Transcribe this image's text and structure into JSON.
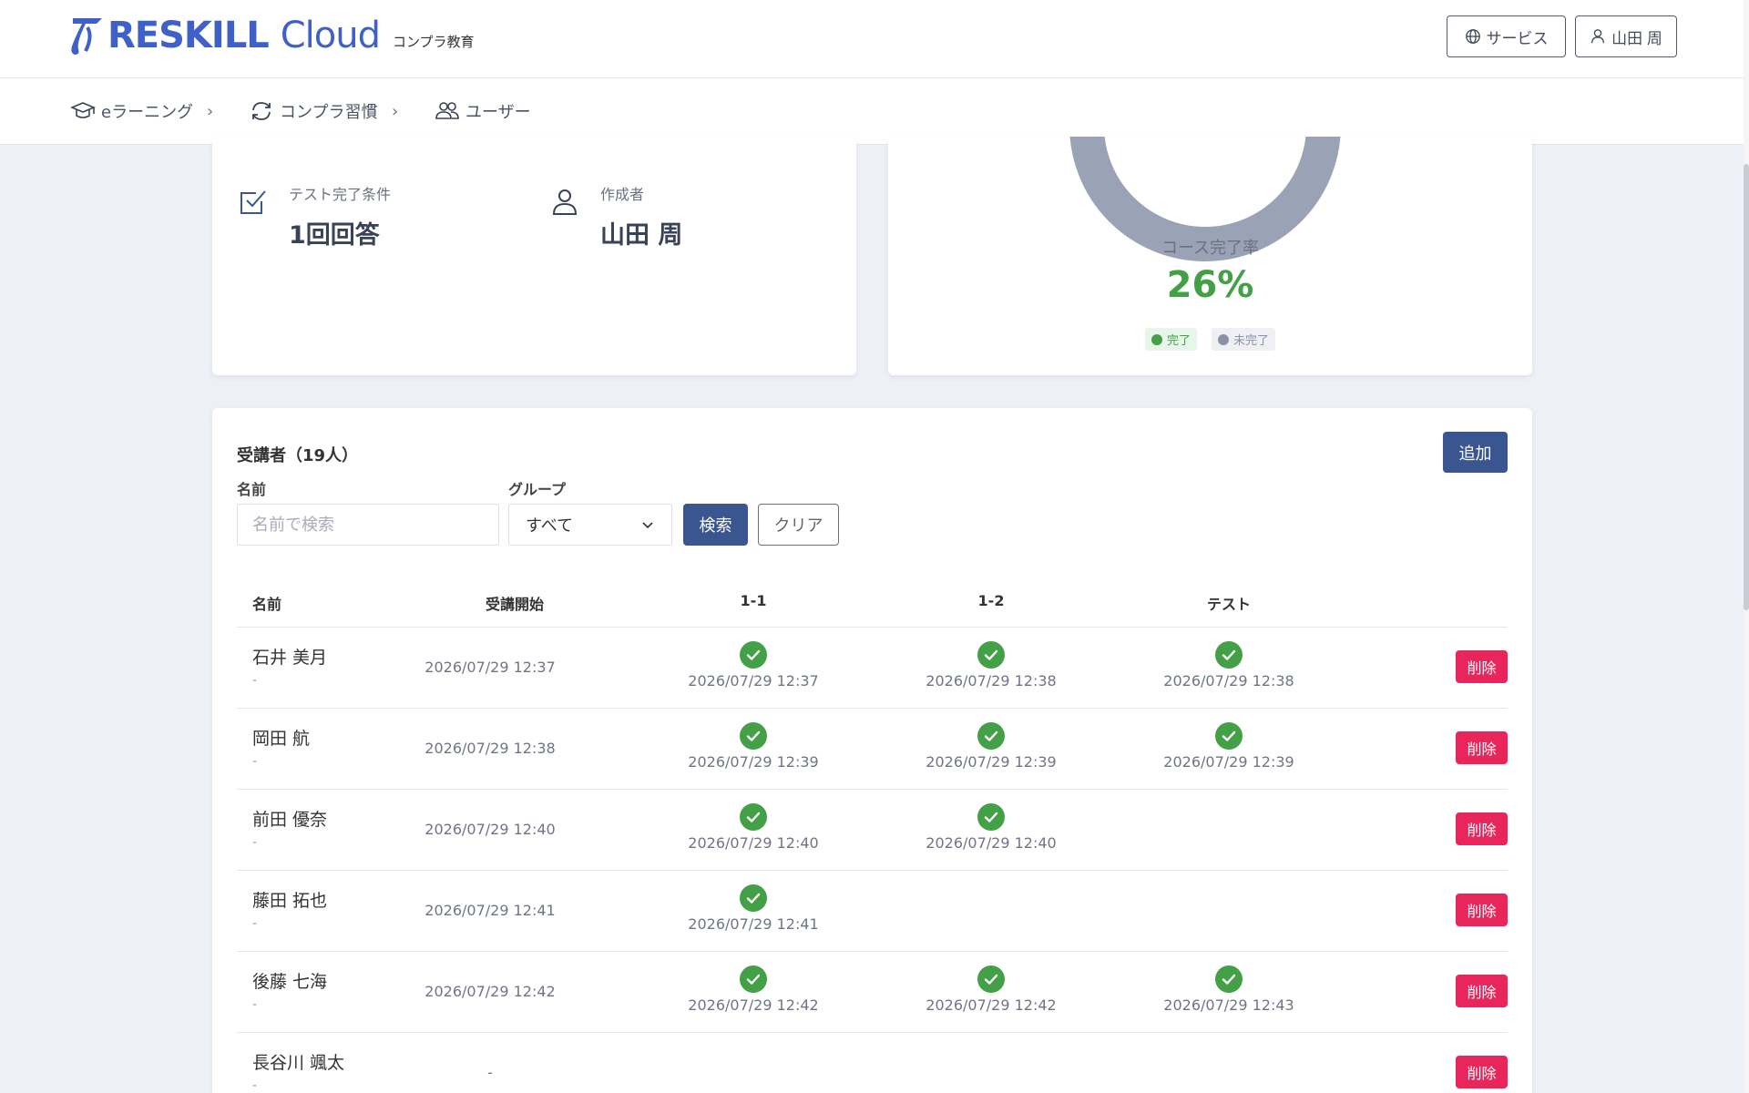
{
  "header": {
    "logo_main": "RESKILL",
    "logo_cloud": "Cloud",
    "subtitle": "コンプラ教育",
    "service_label": "サービス",
    "user_label": "山田 周"
  },
  "breadcrumb": {
    "items": [
      {
        "label": "eラーニング",
        "icon": "graduation-cap-icon"
      },
      {
        "label": "コンプラ習慣",
        "icon": "refresh-icon"
      },
      {
        "label": "ユーザー",
        "icon": "users-icon"
      }
    ]
  },
  "info": {
    "completion_condition_label": "テスト完了条件",
    "completion_condition_value": "1回回答",
    "author_label": "作成者",
    "author_value": "山田 周"
  },
  "chart": {
    "rate_label": "コース完了率",
    "rate_value": "26%",
    "legend_done": "完了",
    "legend_undone": "未完了",
    "colors": {
      "done": "#43a047",
      "undone": "#9aa3b5"
    }
  },
  "participants": {
    "title": "受講者（19人）",
    "add_label": "追加",
    "name_filter_label": "名前",
    "name_placeholder": "名前で検索",
    "group_filter_label": "グループ",
    "group_value": "すべて",
    "search_label": "検索",
    "clear_label": "クリア",
    "columns": {
      "name": "名前",
      "start": "受講開始",
      "c1": "1-1",
      "c2": "1-2",
      "test": "テスト"
    },
    "delete_label": "削除",
    "rows": [
      {
        "name": "石井 美月",
        "sub": "-",
        "start": "2026/07/29 12:37",
        "c1": "2026/07/29 12:37",
        "c2": "2026/07/29 12:38",
        "test": "2026/07/29 12:38"
      },
      {
        "name": "岡田 航",
        "sub": "-",
        "start": "2026/07/29 12:38",
        "c1": "2026/07/29 12:39",
        "c2": "2026/07/29 12:39",
        "test": "2026/07/29 12:39"
      },
      {
        "name": "前田 優奈",
        "sub": "-",
        "start": "2026/07/29 12:40",
        "c1": "2026/07/29 12:40",
        "c2": "2026/07/29 12:40",
        "test": ""
      },
      {
        "name": "藤田 拓也",
        "sub": "-",
        "start": "2026/07/29 12:41",
        "c1": "2026/07/29 12:41",
        "c2": "",
        "test": ""
      },
      {
        "name": "後藤 七海",
        "sub": "-",
        "start": "2026/07/29 12:42",
        "c1": "2026/07/29 12:42",
        "c2": "2026/07/29 12:42",
        "test": "2026/07/29 12:43"
      },
      {
        "name": "長谷川 颯太",
        "sub": "-",
        "start": "-",
        "c1": "",
        "c2": "",
        "test": ""
      }
    ]
  }
}
